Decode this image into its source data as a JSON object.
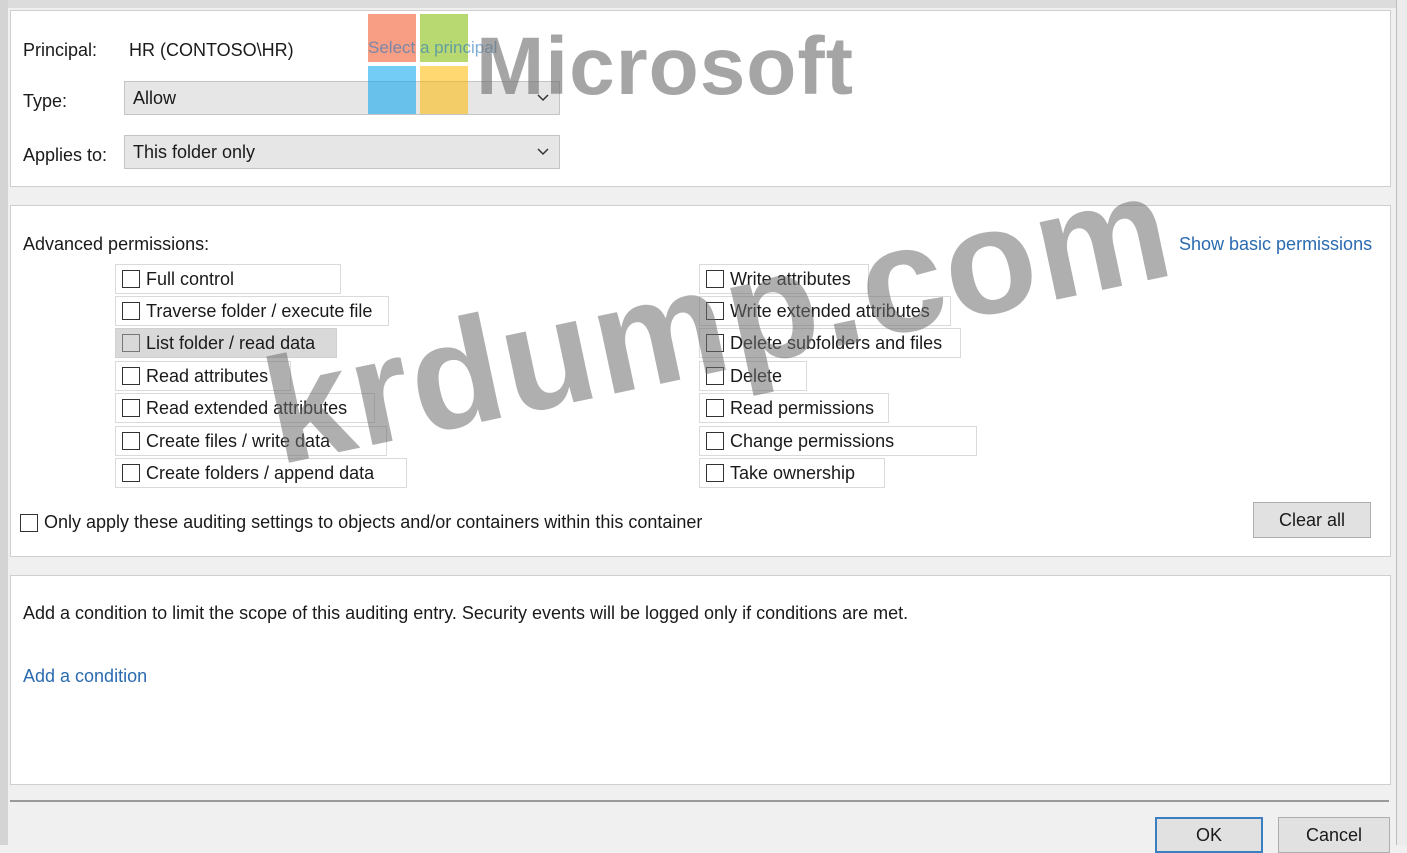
{
  "principal": {
    "label": "Principal:",
    "value": "HR (CONTOSO\\HR)"
  },
  "type": {
    "label": "Type:",
    "value": "Allow"
  },
  "applies_to": {
    "label": "Applies to:",
    "value": "This folder only"
  },
  "advanced": {
    "heading": "Advanced permissions:",
    "show_basic_link": "Show basic permissions",
    "left_permissions": [
      {
        "label": "Full control",
        "checked": false
      },
      {
        "label": "Traverse folder / execute file",
        "checked": false
      },
      {
        "label": "List folder / read data",
        "checked": false
      },
      {
        "label": "Read attributes",
        "checked": false
      },
      {
        "label": "Read extended attributes",
        "checked": false
      },
      {
        "label": "Create files / write data",
        "checked": false
      },
      {
        "label": "Create folders / append data",
        "checked": false
      }
    ],
    "right_permissions": [
      {
        "label": "Write attributes",
        "checked": false
      },
      {
        "label": "Write extended attributes",
        "checked": false
      },
      {
        "label": "Delete subfolders and files",
        "checked": false
      },
      {
        "label": "Delete",
        "checked": false
      },
      {
        "label": "Read permissions",
        "checked": false
      },
      {
        "label": "Change permissions",
        "checked": false
      },
      {
        "label": "Take ownership",
        "checked": false
      }
    ],
    "only_apply_label": "Only apply these auditing settings to objects and/or containers within this container",
    "clear_all": "Clear all"
  },
  "condition": {
    "text": "Add a condition to limit the scope of this auditing entry. Security events will be logged only if conditions are met.",
    "add_link": "Add a condition"
  },
  "buttons": {
    "ok": "OK",
    "cancel": "Cancel"
  },
  "watermark": {
    "select_principal": "Select a principal",
    "brand": "Microsoft",
    "site": "krdump.com",
    "logo_colors": [
      "#f25022",
      "#7fba00",
      "#00a4ef",
      "#ffb900"
    ]
  }
}
